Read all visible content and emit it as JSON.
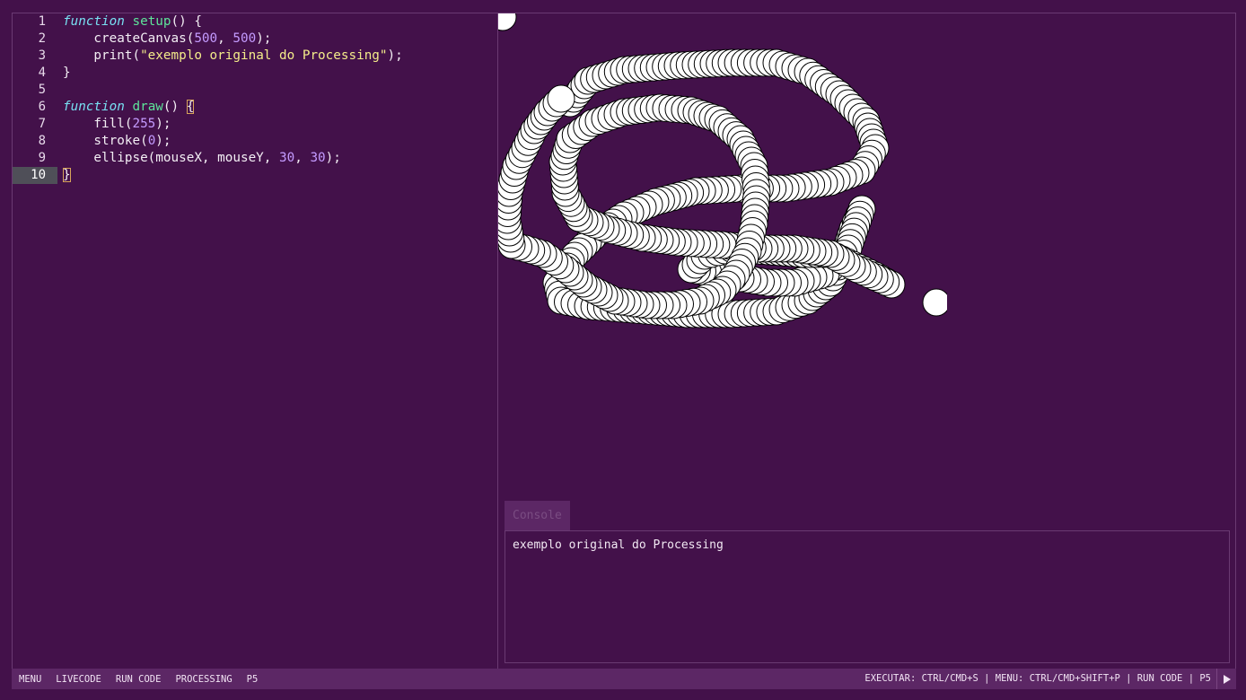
{
  "editor": {
    "line_numbers": [
      "1",
      "2",
      "3",
      "4",
      "5",
      "6",
      "7",
      "8",
      "9",
      "10"
    ],
    "active_line": "10",
    "lines": [
      [
        {
          "t": "function",
          "c": "kw"
        },
        {
          "t": " "
        },
        {
          "t": "setup",
          "c": "fn"
        },
        {
          "t": "() {"
        }
      ],
      [
        {
          "t": "    createCanvas("
        },
        {
          "t": "500",
          "c": "num"
        },
        {
          "t": ", "
        },
        {
          "t": "500",
          "c": "num"
        },
        {
          "t": ");"
        }
      ],
      [
        {
          "t": "    print("
        },
        {
          "t": "\"exemplo original do Processing\"",
          "c": "str"
        },
        {
          "t": ");"
        }
      ],
      [
        {
          "t": "}"
        }
      ],
      [],
      [
        {
          "t": "function",
          "c": "kw"
        },
        {
          "t": " "
        },
        {
          "t": "draw",
          "c": "fn"
        },
        {
          "t": "() "
        },
        {
          "t": "{",
          "c": "bracket"
        }
      ],
      [
        {
          "t": "    fill("
        },
        {
          "t": "255",
          "c": "num"
        },
        {
          "t": ");"
        }
      ],
      [
        {
          "t": "    stroke("
        },
        {
          "t": "0",
          "c": "num"
        },
        {
          "t": ");"
        }
      ],
      [
        {
          "t": "    ellipse(mouseX, mouseY, "
        },
        {
          "t": "30",
          "c": "num"
        },
        {
          "t": ", "
        },
        {
          "t": "30",
          "c": "num"
        },
        {
          "t": ");"
        }
      ],
      [
        {
          "t": "}",
          "c": "bracket"
        }
      ]
    ]
  },
  "console": {
    "tab_label": "Console",
    "output": "exemplo original do Processing"
  },
  "statusbar": {
    "menu": "MENU",
    "livecode": "LIVECODE",
    "run_code": "RUN CODE",
    "processing": "PROCESSING",
    "p5": "P5",
    "shortcuts": "EXECUTAR: CTRL/CMD+S | MENU: CTRL/CMD+SHIFT+P | RUN CODE | P5"
  },
  "sketch": {
    "background": "#43114a",
    "fill": "#ffffff",
    "stroke": "#000000",
    "ellipse_diameter": 30,
    "canvas_size": 500
  },
  "colors": {
    "background": "#43114a",
    "panel": "#5c2765",
    "border": "#6a3a72",
    "keyword": "#78e0f2",
    "function_name": "#5ee59a",
    "number": "#c49bff",
    "string": "#f4ec8a"
  }
}
